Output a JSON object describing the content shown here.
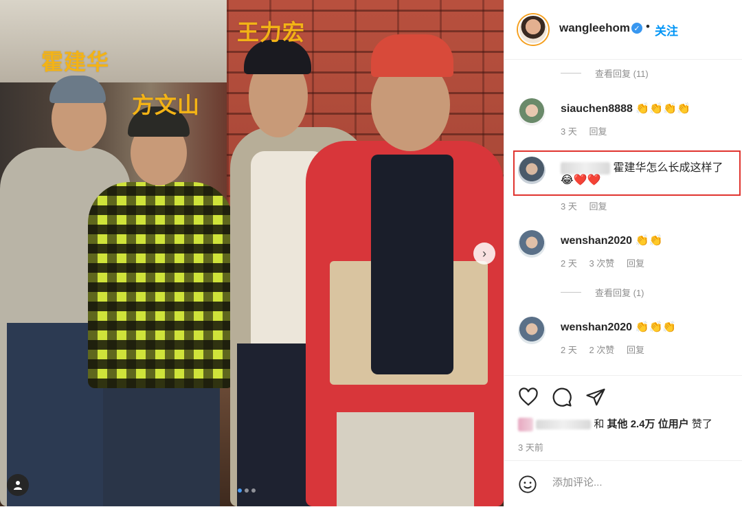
{
  "photo": {
    "labels": {
      "person1": "霍建华",
      "person2": "方文山",
      "person3": "王力宏"
    },
    "carousel": {
      "total": 3,
      "current": 1
    }
  },
  "post": {
    "author": "wangleehom",
    "separator": "•",
    "follow_label": "关注"
  },
  "comments": [
    {
      "type": "view_replies",
      "label": "查看回复 (11)"
    },
    {
      "username": "siauchen8888",
      "text": "👏👏👏👏",
      "time": "3 天",
      "reply": "回复"
    },
    {
      "username_blurred": true,
      "text": "霍建华怎么长成这样了",
      "emoji": "😂❤️❤️",
      "time": "3 天",
      "reply": "回复",
      "highlighted": true
    },
    {
      "username": "wenshan2020",
      "text": "👏👏",
      "time": "2 天",
      "likes": "3 次赞",
      "reply": "回复"
    },
    {
      "type": "view_replies",
      "label": "查看回复 (1)"
    },
    {
      "username": "wenshan2020",
      "text": "👏👏👏",
      "time": "2 天",
      "likes": "2 次赞",
      "reply": "回复"
    }
  ],
  "likes": {
    "and": "和",
    "others_bold": "其他 2.4万 位用户",
    "suffix": "赞了"
  },
  "time_ago": "3 天前",
  "comment_box": {
    "placeholder": "添加评论..."
  },
  "colors": {
    "accent": "#0095f6",
    "highlight": "#e0332e",
    "label": "#f3b316"
  },
  "icons": [
    "heart-icon",
    "comment-icon",
    "share-icon",
    "emoji-icon",
    "chevron-right-icon",
    "user-tag-icon",
    "verified-icon"
  ]
}
